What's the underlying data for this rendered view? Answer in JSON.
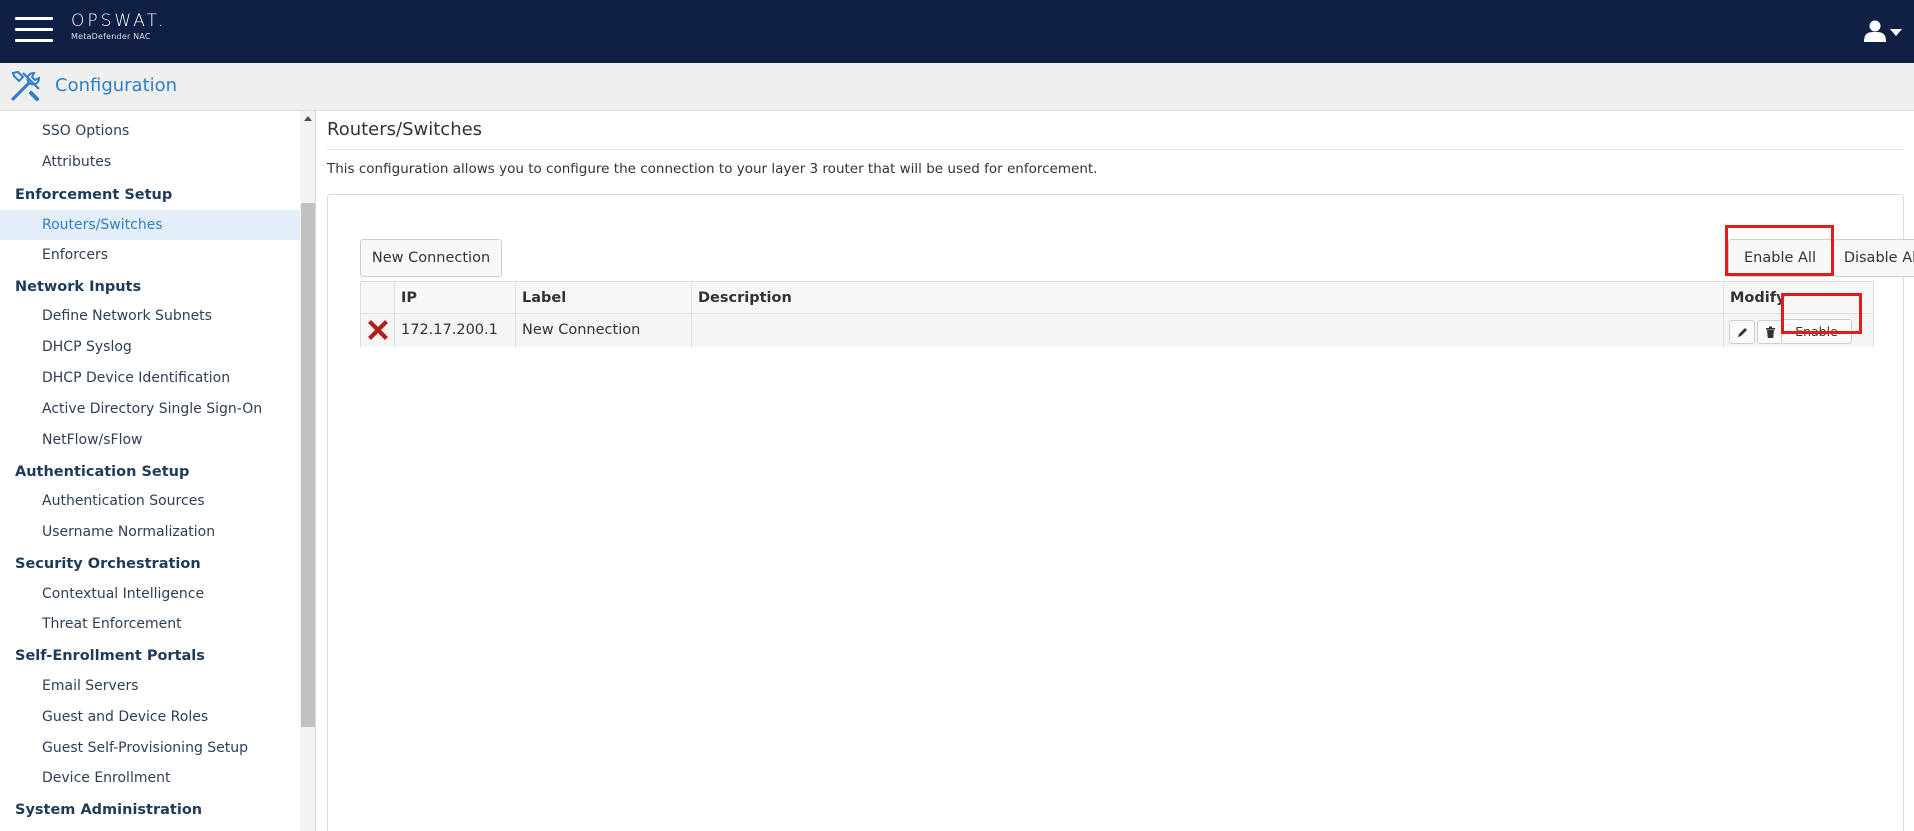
{
  "header": {
    "brand_name": "OPSWAT.",
    "brand_sub": "MetaDefender NAC"
  },
  "subheader": {
    "title": "Configuration"
  },
  "sidebar": {
    "items": [
      {
        "type": "item",
        "label": "SSO Options"
      },
      {
        "type": "item",
        "label": "Attributes"
      },
      {
        "type": "group",
        "label": "Enforcement Setup"
      },
      {
        "type": "item",
        "label": "Routers/Switches",
        "active": true
      },
      {
        "type": "item",
        "label": "Enforcers"
      },
      {
        "type": "group",
        "label": "Network Inputs"
      },
      {
        "type": "item",
        "label": "Define Network Subnets"
      },
      {
        "type": "item",
        "label": "DHCP Syslog"
      },
      {
        "type": "item",
        "label": "DHCP Device Identification"
      },
      {
        "type": "item",
        "label": "Active Directory Single Sign-On"
      },
      {
        "type": "item",
        "label": "NetFlow/sFlow"
      },
      {
        "type": "group",
        "label": "Authentication Setup"
      },
      {
        "type": "item",
        "label": "Authentication Sources"
      },
      {
        "type": "item",
        "label": "Username Normalization"
      },
      {
        "type": "group",
        "label": "Security Orchestration"
      },
      {
        "type": "item",
        "label": "Contextual Intelligence"
      },
      {
        "type": "item",
        "label": "Threat Enforcement"
      },
      {
        "type": "group",
        "label": "Self-Enrollment Portals"
      },
      {
        "type": "item",
        "label": "Email Servers"
      },
      {
        "type": "item",
        "label": "Guest and Device Roles"
      },
      {
        "type": "item",
        "label": "Guest Self-Provisioning Setup"
      },
      {
        "type": "item",
        "label": "Device Enrollment"
      },
      {
        "type": "group",
        "label": "System Administration"
      }
    ]
  },
  "main": {
    "title": "Routers/Switches",
    "description": "This configuration allows you to configure the connection to your layer 3 router that will be used for enforcement.",
    "new_connection_label": "New Connection",
    "enable_all_label": "Enable All",
    "disable_all_label": "Disable All",
    "table": {
      "headers": {
        "ip": "IP",
        "label": "Label",
        "description": "Description",
        "modify": "Modify"
      },
      "rows": [
        {
          "ip": "172.17.200.1",
          "label": "New Connection",
          "description": "",
          "enable_label": "Enable"
        }
      ]
    }
  },
  "colors": {
    "header_bg": "#0f2044",
    "accent": "#2f7fc9",
    "highlight": "#e31b1b",
    "remove": "#b71c1c"
  }
}
